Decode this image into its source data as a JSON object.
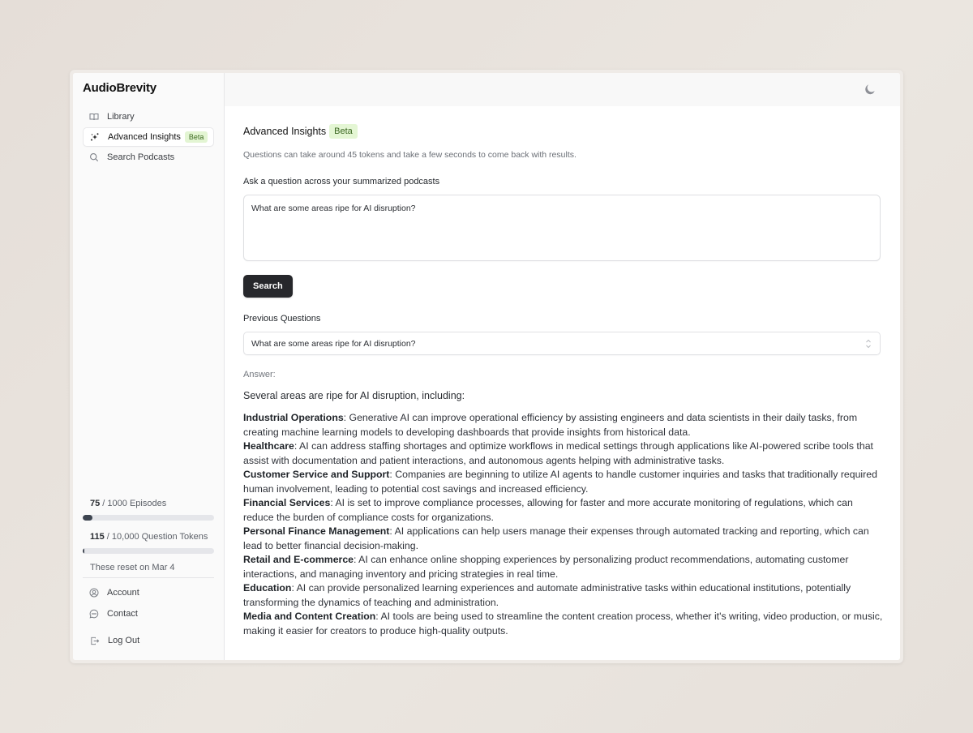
{
  "app": {
    "name": "AudioBrevity"
  },
  "sidebar": {
    "items": [
      {
        "label": "Library",
        "icon": "book-icon",
        "active": false
      },
      {
        "label": "Advanced Insights",
        "icon": "sparkles-icon",
        "active": true,
        "badge": "Beta"
      },
      {
        "label": "Search Podcasts",
        "icon": "search-icon",
        "active": false
      }
    ],
    "usage": {
      "episodes": {
        "used": "75",
        "text": " / 1000 Episodes",
        "fraction": 0.075
      },
      "tokens": {
        "used": "115",
        "text": " / 10,000 Question Tokens",
        "fraction": 0.0115
      },
      "reset_text": "These reset on Mar 4"
    },
    "bottom_items": [
      {
        "label": "Account",
        "icon": "user-circle-icon"
      },
      {
        "label": "Contact",
        "icon": "chat-bubble-icon"
      }
    ],
    "logout_label": "Log Out"
  },
  "topbar": {
    "theme_toggle_icon": "moon-icon"
  },
  "main": {
    "title": "Advanced Insights",
    "title_badge": "Beta",
    "hint": "Questions can take around 45 tokens and take a few seconds to come back with results.",
    "ask_label": "Ask a question across your summarized podcasts",
    "question_value": "What are some areas ripe for AI disruption?",
    "search_button": "Search",
    "previous_label": "Previous Questions",
    "previous_selected": "What are some areas ripe for AI disruption?",
    "answer_label": "Answer:",
    "answer_intro": "Several areas are ripe for AI disruption, including:",
    "answer_items": [
      {
        "heading": "Industrial Operations",
        "text": ": Generative AI can improve operational efficiency by assisting engineers and data scientists in their daily tasks, from creating machine learning models to developing dashboards that provide insights from historical data."
      },
      {
        "heading": "Healthcare",
        "text": ": AI can address staffing shortages and optimize workflows in medical settings through applications like AI-powered scribe tools that assist with documentation and patient interactions, and autonomous agents helping with administrative tasks."
      },
      {
        "heading": "Customer Service and Support",
        "text": ": Companies are beginning to utilize AI agents to handle customer inquiries and tasks that traditionally required human involvement, leading to potential cost savings and increased efficiency."
      },
      {
        "heading": "Financial Services",
        "text": ": AI is set to improve compliance processes, allowing for faster and more accurate monitoring of regulations, which can reduce the burden of compliance costs for organizations."
      },
      {
        "heading": "Personal Finance Management",
        "text": ": AI applications can help users manage their expenses through automated tracking and reporting, which can lead to better financial decision-making."
      },
      {
        "heading": "Retail and E-commerce",
        "text": ": AI can enhance online shopping experiences by personalizing product recommendations, automating customer interactions, and managing inventory and pricing strategies in real time."
      },
      {
        "heading": "Education",
        "text": ": AI can provide personalized learning experiences and automate administrative tasks within educational institutions, potentially transforming the dynamics of teaching and administration."
      },
      {
        "heading": "Media and Content Creation",
        "text": ": AI tools are being used to streamline the content creation process, whether it's writing, video production, or music, making it easier for creators to produce high-quality outputs."
      }
    ]
  }
}
